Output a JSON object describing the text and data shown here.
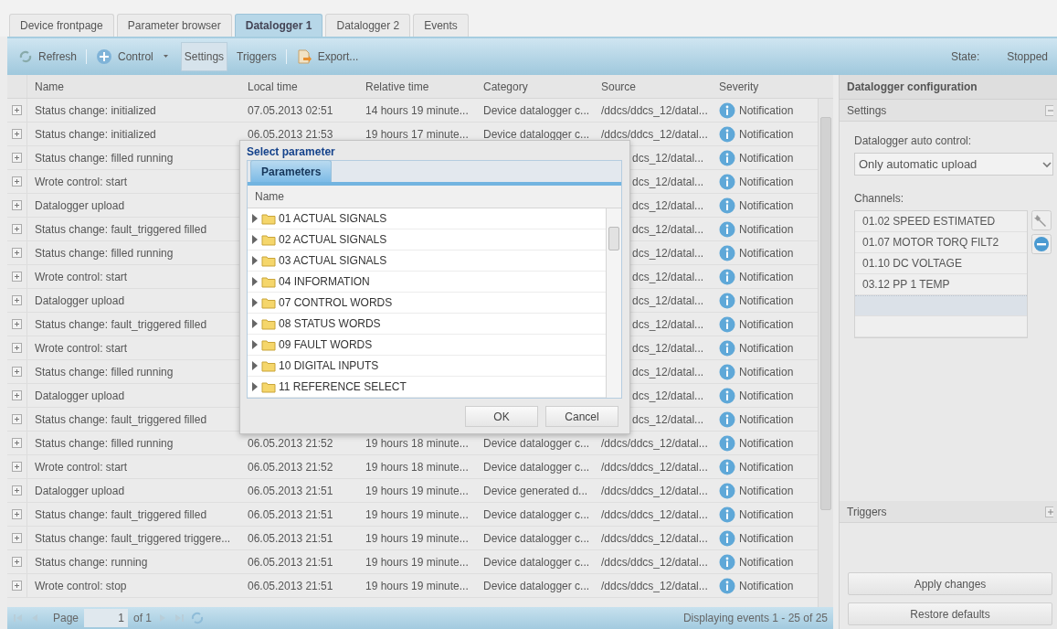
{
  "tabs": [
    {
      "label": "Device frontpage",
      "selected": false
    },
    {
      "label": "Parameter browser",
      "selected": false
    },
    {
      "label": "Datalogger 1",
      "selected": true
    },
    {
      "label": "Datalogger 2",
      "selected": false
    },
    {
      "label": "Events",
      "selected": false
    }
  ],
  "toolbar": {
    "refresh": "Refresh",
    "control": "Control",
    "settings": {
      "label": "Settings",
      "pressed": true
    },
    "triggers": {
      "label": "Triggers",
      "pressed": false
    },
    "export": "Export...",
    "state_label": "State:",
    "state_value": "Stopped"
  },
  "grid": {
    "columns": [
      "Name",
      "Local time",
      "Relative time",
      "Category",
      "Source",
      "Severity"
    ],
    "rows": [
      {
        "name": "Status change: initialized",
        "local_time": "07.05.2013 02:51",
        "relative_time": "14 hours 19 minute...",
        "category": "Device datalogger c...",
        "source": "/ddcs/ddcs_12/datal...",
        "severity": "Notification"
      },
      {
        "name": "Status change: initialized",
        "local_time": "06.05.2013 21:53",
        "relative_time": "19 hours 17 minute...",
        "category": "Device datalogger c...",
        "source": "/ddcs/ddcs_12/datal...",
        "severity": "Notification"
      },
      {
        "name": "Status change: filled running",
        "source": "dcs_12/datal...",
        "severity": "Notification"
      },
      {
        "name": "Wrote control: start",
        "source": "dcs_12/datal...",
        "severity": "Notification"
      },
      {
        "name": "Datalogger upload",
        "source": "dcs_12/datal...",
        "severity": "Notification"
      },
      {
        "name": "Status change: fault_triggered filled",
        "source": "dcs_12/datal...",
        "severity": "Notification"
      },
      {
        "name": "Status change: filled running",
        "source": "dcs_12/datal...",
        "severity": "Notification"
      },
      {
        "name": "Wrote control: start",
        "source": "dcs_12/datal...",
        "severity": "Notification"
      },
      {
        "name": "Datalogger upload",
        "source": "dcs_12/datal...",
        "severity": "Notification"
      },
      {
        "name": "Status change: fault_triggered filled",
        "source": "dcs_12/datal...",
        "severity": "Notification"
      },
      {
        "name": "Wrote control: start",
        "source": "dcs_12/datal...",
        "severity": "Notification"
      },
      {
        "name": "Status change: filled running",
        "source": "dcs_12/datal...",
        "severity": "Notification"
      },
      {
        "name": "Datalogger upload",
        "source": "dcs_12/datal...",
        "severity": "Notification"
      },
      {
        "name": "Status change: fault_triggered filled",
        "source": "dcs_12/datal...",
        "severity": "Notification"
      },
      {
        "name": "Status change: filled running",
        "local_time": "06.05.2013 21:52",
        "relative_time": "19 hours 18 minute...",
        "category": "Device datalogger c...",
        "source": "/ddcs/ddcs_12/datal...",
        "severity": "Notification"
      },
      {
        "name": "Wrote control: start",
        "local_time": "06.05.2013 21:52",
        "relative_time": "19 hours 18 minute...",
        "category": "Device datalogger c...",
        "source": "/ddcs/ddcs_12/datal...",
        "severity": "Notification"
      },
      {
        "name": "Datalogger upload",
        "local_time": "06.05.2013 21:51",
        "relative_time": "19 hours 19 minute...",
        "category": "Device generated d...",
        "source": "/ddcs/ddcs_12/datal...",
        "severity": "Notification"
      },
      {
        "name": "Status change: fault_triggered filled",
        "local_time": "06.05.2013 21:51",
        "relative_time": "19 hours 19 minute...",
        "category": "Device datalogger c...",
        "source": "/ddcs/ddcs_12/datal...",
        "severity": "Notification"
      },
      {
        "name": "Status change: fault_triggered triggere...",
        "local_time": "06.05.2013 21:51",
        "relative_time": "19 hours 19 minute...",
        "category": "Device datalogger c...",
        "source": "/ddcs/ddcs_12/datal...",
        "severity": "Notification"
      },
      {
        "name": "Status change: running",
        "local_time": "06.05.2013 21:51",
        "relative_time": "19 hours 19 minute...",
        "category": "Device datalogger c...",
        "source": "/ddcs/ddcs_12/datal...",
        "severity": "Notification"
      },
      {
        "name": "Wrote control: stop",
        "local_time": "06.05.2013 21:51",
        "relative_time": "19 hours 19 minute...",
        "category": "Device datalogger c...",
        "source": "/ddcs/ddcs_12/datal...",
        "severity": "Notification"
      }
    ]
  },
  "pager": {
    "page_label": "Page",
    "page": "1",
    "of": "of 1",
    "summary": "Displaying events 1 - 25 of 25"
  },
  "dialog": {
    "title": "Select parameter",
    "tab": {
      "label": "Parameters",
      "selected": true
    },
    "column": "Name",
    "items": [
      "01 ACTUAL SIGNALS",
      "02 ACTUAL SIGNALS",
      "03 ACTUAL SIGNALS",
      "04 INFORMATION",
      "07 CONTROL WORDS",
      "08 STATUS WORDS",
      "09 FAULT WORDS",
      "10 DIGITAL INPUTS",
      "11 REFERENCE SELECT"
    ],
    "buttons": [
      "OK",
      "Cancel"
    ]
  },
  "panel": {
    "title": "Datalogger configuration",
    "sections": [
      {
        "title": "Settings",
        "expanded": true
      },
      {
        "title": "Triggers",
        "expanded": false
      }
    ],
    "auto_control_label": "Datalogger auto control:",
    "auto_control_value": "Only automatic upload",
    "channels_label": "Channels:",
    "channels": [
      "01.02 SPEED ESTIMATED",
      "01.07 MOTOR TORQ FILT2",
      "01.10 DC VOLTAGE",
      "03.12 PP 1 TEMP"
    ],
    "buttons": [
      "Apply changes",
      "Restore defaults"
    ]
  }
}
